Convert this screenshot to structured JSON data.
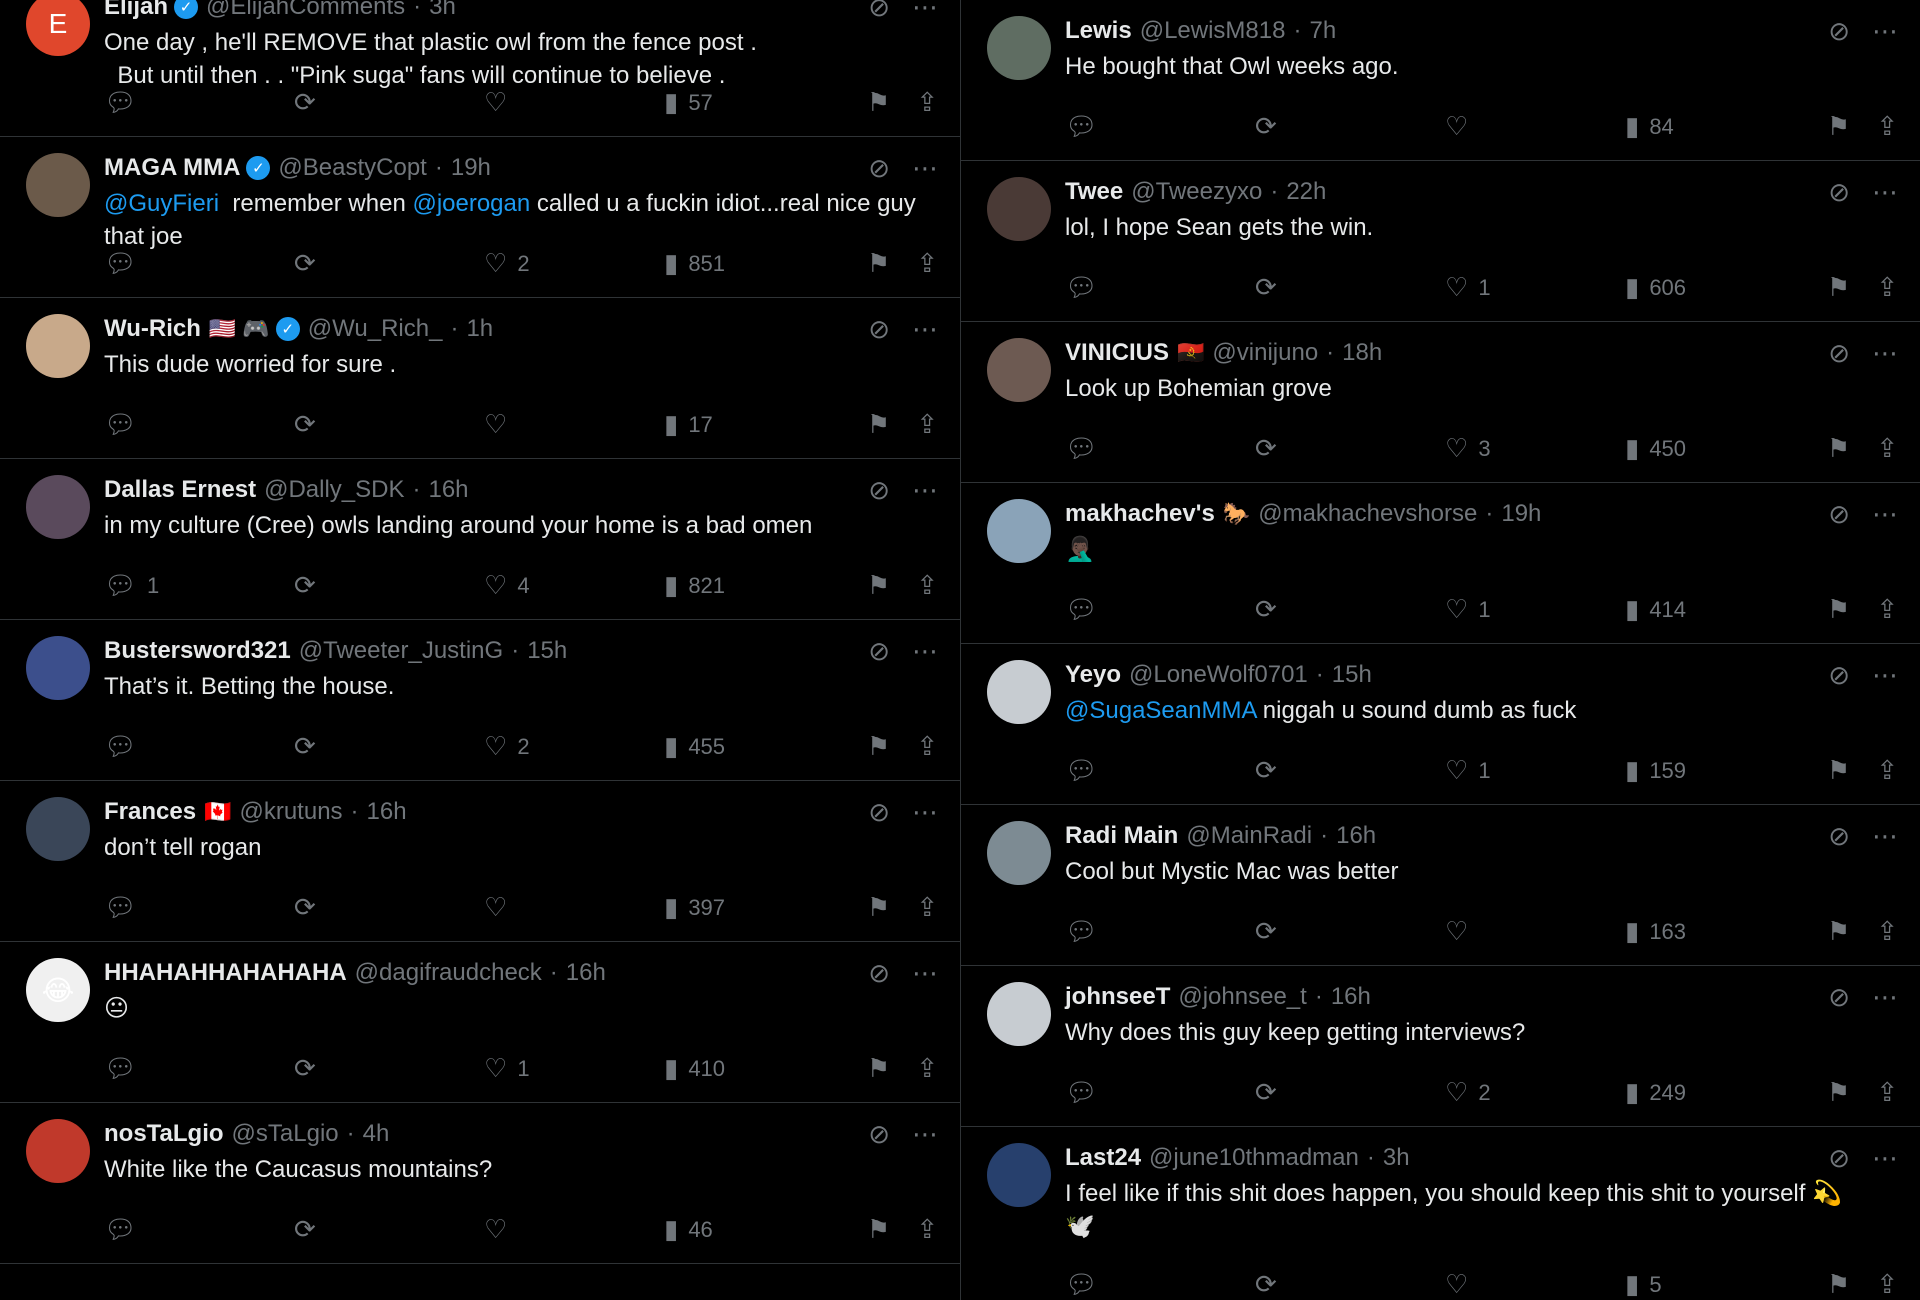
{
  "left": [
    {
      "name": "Elijah",
      "verified": true,
      "extra": "",
      "handle": "@ElijahComments",
      "time": "3h",
      "text": "One day , he'll REMOVE that plastic owl from the fence post .\n  But until then . . \"Pink suga\" fans will continue to believe .",
      "replies": "",
      "likes": "",
      "views": "57",
      "avatar_text": "E",
      "avatar_color": "#e0472c"
    },
    {
      "name": "MAGA MMA",
      "verified": true,
      "extra": "",
      "handle": "@BeastyCopt",
      "time": "19h",
      "mention1": "@GuyFieri",
      "mid": "  remember when ",
      "mention2": "@joerogan",
      "tail": " called u a fuckin idiot...real nice guy that joe",
      "replies": "",
      "likes": "2",
      "views": "851",
      "avatar_text": "",
      "avatar_color": "#6b5a4a"
    },
    {
      "name": "Wu-Rich",
      "verified": true,
      "extra": "🇺🇸 🎮",
      "handle": "@Wu_Rich_",
      "time": "1h",
      "text": "This dude worried for sure .",
      "replies": "",
      "likes": "",
      "views": "17",
      "avatar_text": "",
      "avatar_color": "#c8a98a"
    },
    {
      "name": "Dallas Ernest",
      "verified": false,
      "extra": "",
      "handle": "@Dally_SDK",
      "time": "16h",
      "text": "in my culture (Cree) owls landing around your home is a bad omen",
      "replies": "1",
      "likes": "4",
      "views": "821",
      "avatar_text": "",
      "avatar_color": "#5a4a5c"
    },
    {
      "name": "Bustersword321",
      "verified": false,
      "extra": "",
      "handle": "@Tweeter_JustinG",
      "time": "15h",
      "text": "That’s it. Betting the house.",
      "replies": "",
      "likes": "2",
      "views": "455",
      "avatar_text": "",
      "avatar_color": "#3c4f8c"
    },
    {
      "name": "Frances",
      "verified": false,
      "extra": "🇨🇦",
      "handle": "@krutuns",
      "time": "16h",
      "text": "don’t tell rogan",
      "replies": "",
      "likes": "",
      "views": "397",
      "avatar_text": "",
      "avatar_color": "#3a4658"
    },
    {
      "name": "HHAHAHHAHAHAHA",
      "verified": false,
      "extra": "",
      "handle": "@dagifraudcheck",
      "time": "16h",
      "text": "😐",
      "replies": "",
      "likes": "1",
      "views": "410",
      "avatar_text": "😂",
      "avatar_color": "#f0f0f0"
    },
    {
      "name": "nosTaLgio",
      "verified": false,
      "extra": "",
      "handle": "@sTaLgio",
      "time": "4h",
      "text": "White like the Caucasus mountains?",
      "replies": "",
      "likes": "",
      "views": "46",
      "avatar_text": "",
      "avatar_color": "#c0392b"
    }
  ],
  "right": [
    {
      "name": "Lewis",
      "verified": false,
      "extra": "",
      "handle": "@LewisM818",
      "time": "7h",
      "text": "He bought that Owl weeks ago.",
      "replies": "",
      "likes": "",
      "views": "84",
      "avatar_text": "",
      "avatar_color": "#5f6d62"
    },
    {
      "name": "Twee",
      "verified": false,
      "extra": "",
      "handle": "@Tweezyxo",
      "time": "22h",
      "text": "lol, I hope Sean gets the win.",
      "replies": "",
      "likes": "1",
      "views": "606",
      "avatar_text": "",
      "avatar_color": "#4a3a36"
    },
    {
      "name": "VINICIUS",
      "verified": false,
      "extra": "🇦🇴",
      "handle": "@vinijuno",
      "time": "18h",
      "text": "Look up Bohemian grove",
      "replies": "",
      "likes": "3",
      "views": "450",
      "avatar_text": "",
      "avatar_color": "#6d5a52"
    },
    {
      "name": "makhachev's",
      "verified": false,
      "extra": "🐎",
      "handle": "@makhachevshorse",
      "time": "19h",
      "text": "🤦🏿‍♂️",
      "replies": "",
      "likes": "1",
      "views": "414",
      "avatar_text": "",
      "avatar_color": "#8aa3b8"
    },
    {
      "name": "Yeyo",
      "verified": false,
      "extra": "",
      "handle": "@LoneWolf0701",
      "time": "15h",
      "mention1": "@SugaSeanMMA",
      "tail": " niggah u sound dumb as fuck",
      "replies": "",
      "likes": "1",
      "views": "159",
      "avatar_text": "",
      "avatar_color": "#c7ccd1"
    },
    {
      "name": "Radi Main",
      "verified": false,
      "extra": "",
      "handle": "@MainRadi",
      "time": "16h",
      "text": "Cool but Mystic Mac was better",
      "replies": "",
      "likes": "",
      "views": "163",
      "avatar_text": "",
      "avatar_color": "#7d8b93"
    },
    {
      "name": "johnseeT",
      "verified": false,
      "extra": "",
      "handle": "@johnsee_t",
      "time": "16h",
      "text": "Why does this guy keep getting interviews?",
      "replies": "",
      "likes": "2",
      "views": "249",
      "avatar_text": "",
      "avatar_color": "#c7ccd1"
    },
    {
      "name": "Last24",
      "verified": false,
      "extra": "",
      "handle": "@june10thmadman",
      "time": "3h",
      "text": "I feel like if this shit does happen, you should keep this shit to yourself 💫\n🕊️",
      "replies": "",
      "likes": "",
      "views": "5",
      "avatar_text": "",
      "avatar_color": "#27406d"
    }
  ],
  "icons": {
    "reply": "reply-icon",
    "retweet": "retweet-icon",
    "like": "heart-icon",
    "views": "views-icon",
    "bookmark": "bookmark-icon",
    "share": "share-icon",
    "grok": "grok-icon",
    "more": "more-icon"
  },
  "sep": "·"
}
